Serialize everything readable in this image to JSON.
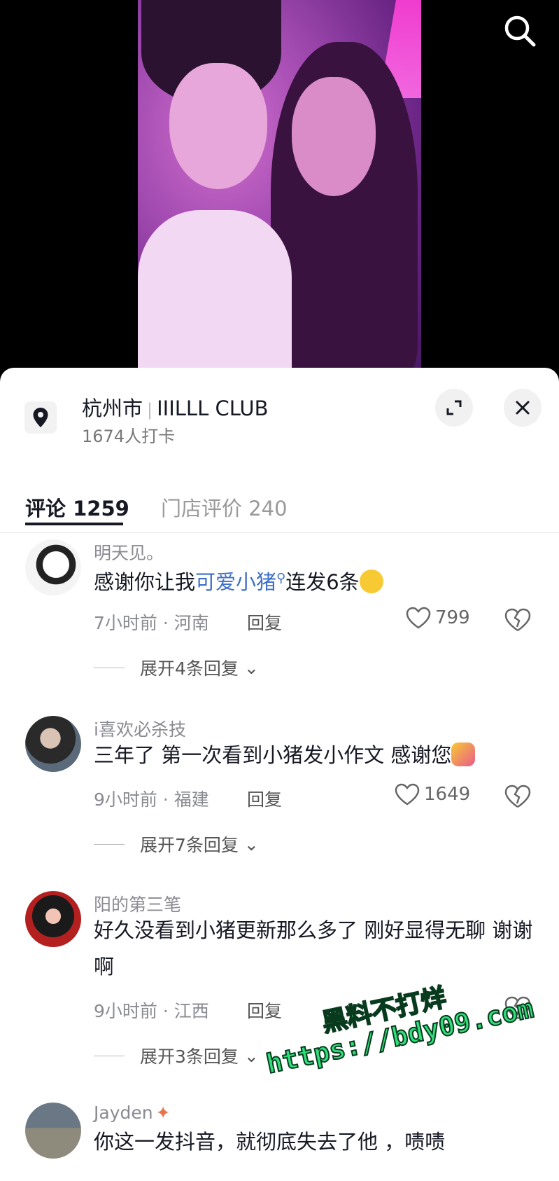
{
  "location": {
    "city": "杭州市",
    "venue": "IIILLL CLUB",
    "checkins": "1674人打卡"
  },
  "tabs": {
    "comments": "评论 1259",
    "reviews": "门店评价 240"
  },
  "comments": [
    {
      "user": "明天见。",
      "text_before": "感谢你让我",
      "link": "可爱小猪",
      "text_after": "连发6条",
      "meta": "7小时前 · 河南",
      "reply": "回复",
      "likes": "799",
      "expand": "展开4条回复"
    },
    {
      "user": "i喜欢必杀技",
      "text": "三年了 第一次看到小猪发小作文 感谢您",
      "meta": "9小时前 · 福建",
      "reply": "回复",
      "likes": "1649",
      "expand": "展开7条回复"
    },
    {
      "user": "阳的第三笔",
      "text": "好久没看到小猪更新那么多了 刚好显得无聊 谢谢啊",
      "meta": "9小时前 · 江西",
      "reply": "回复",
      "likes": "",
      "expand": "展开3条回复"
    },
    {
      "user": "Jayden",
      "text": "你这一发抖音，就彻底失去了他 ，啧啧"
    }
  ],
  "watermark": {
    "line1": "黑料不打烊",
    "line2": "https://bdy09.com"
  },
  "colors": {
    "link": "#3d6fc9",
    "text": "#161823",
    "muted": "#8a8b91"
  }
}
